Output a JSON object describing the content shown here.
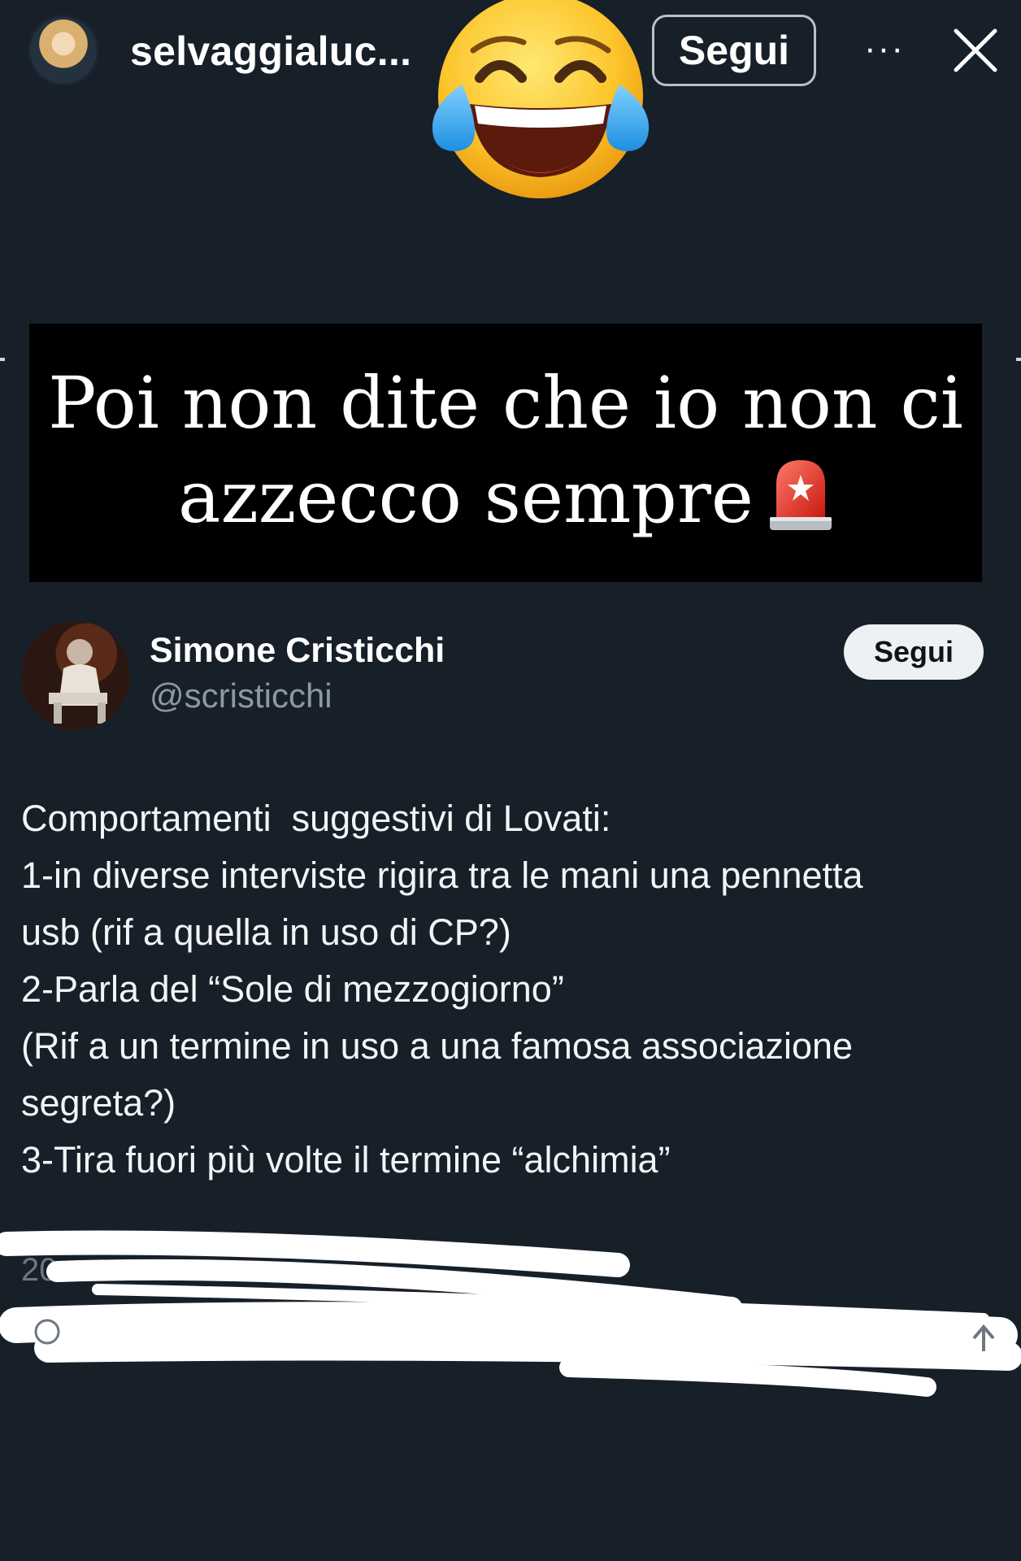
{
  "header": {
    "username": "selvaggialuc...",
    "follow_label": "Segui",
    "more_label": "···",
    "icons": {
      "avatar": "profile-avatar",
      "more": "more-dots-icon",
      "close": "close-icon"
    }
  },
  "sticker": {
    "icon": "tears-of-joy-emoji"
  },
  "caption": {
    "line1": "Poi non dite che io non ci",
    "line2": "azzecco sempre",
    "icon": "police-siren-emoji"
  },
  "tweet": {
    "author_name": "Simone Cristicchi",
    "author_handle": "@scristicchi",
    "follow_label": "Segui",
    "lines": [
      "Comportamenti  suggestivi di Lovati:",
      "1-in diverse interviste rigira tra le mani una pennetta",
      "usb (rif a quella in uso di CP?)",
      "2-Parla del “Sole di mezzogiorno”",
      "(Rif a un termine in uso a una famosa associazione",
      "segreta?)",
      "3-Tira fuori più volte il termine “alchimia”"
    ],
    "date_fragment": "20"
  },
  "colors": {
    "background": "#172029",
    "banner": "#000000",
    "handle": "#8d98a3",
    "follow_pill": "#eef1f4"
  }
}
